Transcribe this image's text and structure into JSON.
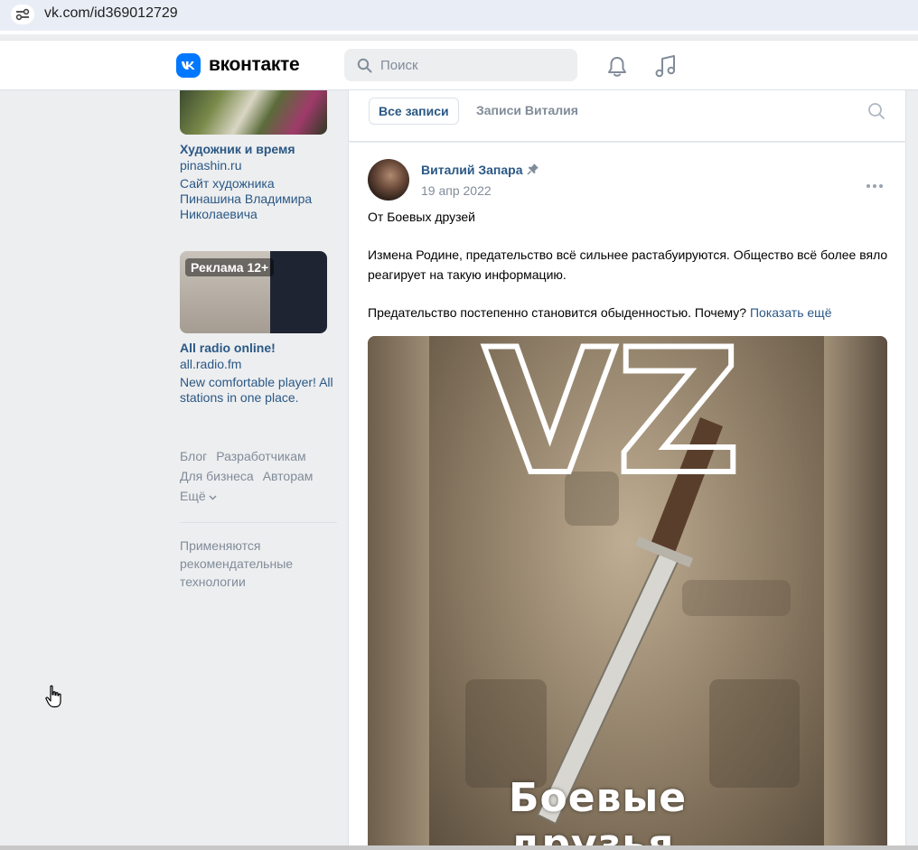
{
  "browser": {
    "url": "vk.com/id369012729"
  },
  "header": {
    "logo_text": "вконтакте",
    "search_placeholder": "Поиск",
    "brand_color": "#0077ff"
  },
  "sidebar": {
    "ad1": {
      "title": "Художник и время",
      "domain": "pinashin.ru",
      "description": "Сайт художника Пинашина Владимира Николаевича"
    },
    "ad2": {
      "label": "Реклама 12+",
      "title": "All radio online!",
      "domain": "all.radio.fm",
      "description": "New comfortable player! All stations in one place."
    },
    "footer_links": [
      "Блог",
      "Разработчикам",
      "Для бизнеса",
      "Авторам",
      "Ещё"
    ],
    "footer_note": "Применяются рекомендательные технологии"
  },
  "wall": {
    "tabs": [
      "Все записи",
      "Записи Виталия"
    ]
  },
  "post": {
    "author": "Виталий Запара",
    "date": "19 апр 2022",
    "paragraph1": "От Боевых друзей",
    "paragraph2": "Измена Родине, предательство всё сильнее растабуируются. Общество всё более вяло реагирует на такую информацию.",
    "paragraph3": "Предательство постепенно становится обыденностью. Почему?",
    "show_more": "Показать ещё",
    "image_caption": "Боевые друзья",
    "image_letters": "VZ"
  }
}
